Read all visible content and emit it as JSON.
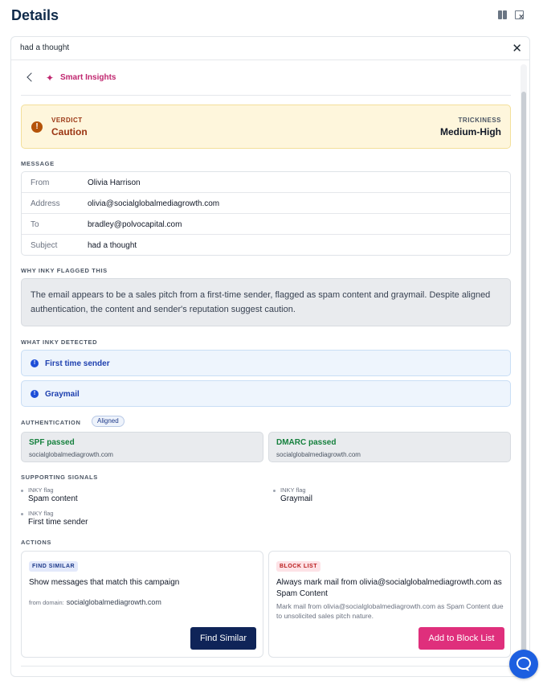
{
  "app": {
    "title": "Details"
  },
  "panel": {
    "title": "had a thought"
  },
  "nav": {
    "section": "Smart Insights"
  },
  "verdict": {
    "label": "VERDICT",
    "value": "Caution",
    "trickiness_label": "TRICKINESS",
    "trickiness_value": "Medium-High"
  },
  "message": {
    "section_label": "MESSAGE",
    "rows": [
      {
        "key": "From",
        "value": "Olivia Harrison"
      },
      {
        "key": "Address",
        "value": "olivia@socialglobalmediagrowth.com"
      },
      {
        "key": "To",
        "value": "bradley@polvocapital.com"
      },
      {
        "key": "Subject",
        "value": "had a thought"
      }
    ]
  },
  "why": {
    "section_label": "WHY INKY FLAGGED THIS",
    "text": "The email appears to be a sales pitch from a first-time sender, flagged as spam content and graymail. Despite aligned authentication, the content and sender's reputation suggest caution."
  },
  "detected": {
    "section_label": "WHAT INKY DETECTED",
    "items": [
      "First time sender",
      "Graymail"
    ]
  },
  "authentication": {
    "section_label": "AUTHENTICATION",
    "badge": "Aligned",
    "checks": [
      {
        "title": "SPF passed",
        "domain": "socialglobalmediagrowth.com"
      },
      {
        "title": "DMARC passed",
        "domain": "socialglobalmediagrowth.com"
      }
    ]
  },
  "signals": {
    "section_label": "SUPPORTING SIGNALS",
    "items": [
      {
        "kicker": "INKY flag",
        "label": "Spam content"
      },
      {
        "kicker": "INKY flag",
        "label": "Graymail"
      },
      {
        "kicker": "INKY flag",
        "label": "First time sender"
      }
    ]
  },
  "actions": {
    "section_label": "ACTIONS",
    "find_similar": {
      "badge": "FIND SIMILAR",
      "title": "Show messages that match this campaign",
      "sub_label": "from domain:",
      "sub_domain": "socialglobalmediagrowth.com",
      "button": "Find Similar"
    },
    "block_list": {
      "badge": "BLOCK LIST",
      "title": "Always mark mail from olivia@socialglobalmediagrowth.com as Spam Content",
      "description": "Mark mail from olivia@socialglobalmediagrowth.com as Spam Content due to unsolicited sales pitch nature.",
      "button": "Add to Block List"
    }
  },
  "colors": {
    "accent_pink": "#df2f7c",
    "navy": "#0f2458",
    "caution": "#9a3412",
    "chat": "#1d5fe0"
  }
}
